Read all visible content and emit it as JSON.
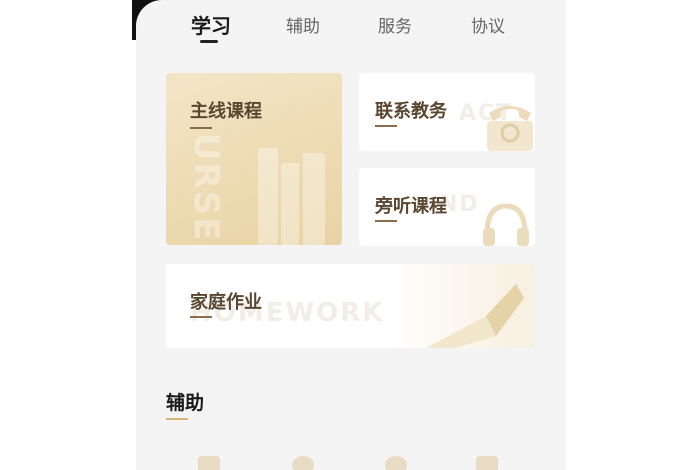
{
  "tabs": [
    {
      "label": "学习",
      "active": true
    },
    {
      "label": "辅助",
      "active": false
    },
    {
      "label": "服务",
      "active": false
    },
    {
      "label": "协议",
      "active": false
    }
  ],
  "cards": {
    "main_course": {
      "title": "主线课程",
      "watermark": "URSE"
    },
    "contact": {
      "title": "联系教务",
      "watermark": "ACT"
    },
    "audit": {
      "title": "旁听课程",
      "watermark": "ND"
    },
    "homework": {
      "title": "家庭作业",
      "watermark": "HOMEWORK"
    }
  },
  "section": {
    "title": "辅助"
  },
  "icons": [
    "phone-icon",
    "headphones-icon",
    "pen-icon",
    "book-icon",
    "person-pin-icon",
    "cart-icon",
    "document-icon"
  ],
  "colors": {
    "accent": "#d8b77c",
    "title_brown": "#5b4630",
    "background": "#f4f4f4"
  }
}
